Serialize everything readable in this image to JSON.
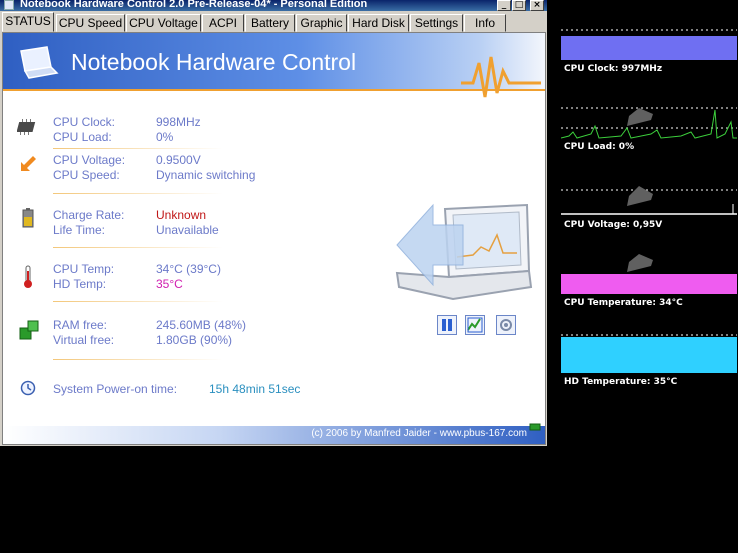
{
  "window": {
    "title": "Notebook Hardware Control 2.0 Pre-Release-04* - Personal Edition",
    "buttons": {
      "minimize": "_",
      "maximize": "□",
      "close": "×"
    }
  },
  "tabs": [
    "STATUS",
    "CPU Speed",
    "CPU Voltage",
    "ACPI",
    "Battery",
    "Graphic",
    "Hard Disk",
    "Settings",
    "Info"
  ],
  "active_tab": "STATUS",
  "header": {
    "title": "Notebook Hardware Control"
  },
  "status": {
    "cpu_clock_label": "CPU Clock:",
    "cpu_clock_value": "998MHz",
    "cpu_load_label": "CPU Load:",
    "cpu_load_value": "0%",
    "cpu_voltage_label": "CPU Voltage:",
    "cpu_voltage_value": "0.9500V",
    "cpu_speed_label": "CPU Speed:",
    "cpu_speed_value": "Dynamic switching",
    "charge_rate_label": "Charge Rate:",
    "charge_rate_value": "Unknown",
    "life_time_label": "Life Time:",
    "life_time_value": "Unavailable",
    "cpu_temp_label": "CPU Temp:",
    "cpu_temp_value": "34°C (39°C)",
    "hd_temp_label": "HD Temp:",
    "hd_temp_value": "35°C",
    "ram_free_label": "RAM free:",
    "ram_free_value": "245.60MB (48%)",
    "virtual_free_label": "Virtual free:",
    "virtual_free_value": "1.80GB (90%)",
    "power_on_label": "System Power-on time:",
    "power_on_value": "15h  48min  51sec"
  },
  "icons": [
    "chip-icon",
    "voltage-arrow-icon",
    "battery-icon",
    "thermometer-icon",
    "memory-icon",
    "clock-icon",
    "laptop-illustration-icon",
    "pause-icon",
    "graph-icon",
    "settings-icon"
  ],
  "footer": {
    "credit": "(c) 2006 by Manfred Jaider  -  www.pbus-167.com"
  },
  "monitors": [
    {
      "label": "CPU Clock: 997MHz",
      "color": "#6f6ff2",
      "level": 0.4
    },
    {
      "label": "CPU Load: 0%",
      "color": "#3ccf3c",
      "level": 0.0
    },
    {
      "label": "CPU Voltage: 0,95V",
      "color": "#a0a0a0",
      "level": 0.0
    },
    {
      "label": "CPU Temperature: 34°C",
      "color": "#ef5cf0",
      "level": 0.4
    },
    {
      "label": "HD Temperature: 35°C",
      "color": "#2fd0ff",
      "level": 0.7
    }
  ],
  "colors": {
    "label": "#6c7ac9",
    "warning": "#c01818",
    "highlight": "#d020b0",
    "accent": "#f0a030",
    "header_blue": "#2f5fc2"
  }
}
